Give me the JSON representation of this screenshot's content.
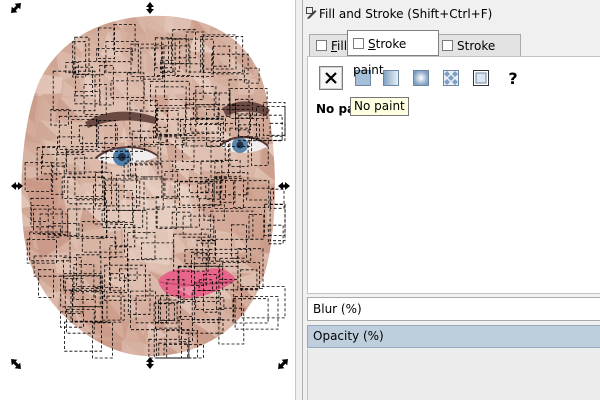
{
  "canvas": {
    "artwork": "low-poly face mosaic",
    "selection": "dashed bounding boxes around polygons",
    "handle_icon": "double-arrow-scale-handle"
  },
  "panel": {
    "title": "Fill and Stroke (Shift+Ctrl+F)",
    "title_icon": "fill-stroke-icon",
    "tabs": {
      "fill": {
        "pre": "",
        "mn": "F",
        "post": "ill"
      },
      "stroke_paint": {
        "pre": "",
        "mn": "S",
        "post": "troke paint"
      },
      "stroke_style": {
        "pre": "Stroke st",
        "mn": "y",
        "post": "le"
      }
    },
    "paint_buttons": [
      {
        "name": "no-paint-icon",
        "active": true
      },
      {
        "name": "flat-color-icon",
        "active": false
      },
      {
        "name": "linear-gradient-icon",
        "active": false
      },
      {
        "name": "radial-gradient-icon",
        "active": false
      },
      {
        "name": "pattern-icon",
        "active": false
      },
      {
        "name": "swatch-icon",
        "active": false
      },
      {
        "name": "unset-paint-icon",
        "active": false
      }
    ],
    "status": "No paint",
    "tooltip": "No paint",
    "blur_label": "Blur (%)",
    "opacity_label": "Opacity (%)"
  }
}
